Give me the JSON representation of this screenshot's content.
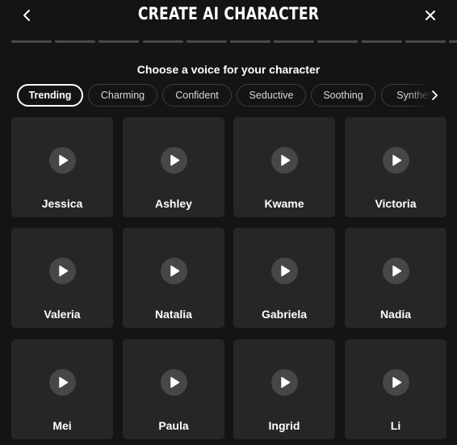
{
  "header": {
    "title": "CREATE AI CHARACTER",
    "back_icon": "chevron-left-icon",
    "close_icon": "close-icon"
  },
  "progress": {
    "steps_total": 11,
    "steps_completed": 0
  },
  "prompt": "Choose a voice for your character",
  "tabs": [
    {
      "label": "Trending",
      "selected": true
    },
    {
      "label": "Charming",
      "selected": false
    },
    {
      "label": "Confident",
      "selected": false
    },
    {
      "label": "Seductive",
      "selected": false
    },
    {
      "label": "Soothing",
      "selected": false
    },
    {
      "label": "Synthetic",
      "selected": false
    }
  ],
  "voices": [
    {
      "name": "Jessica"
    },
    {
      "name": "Ashley"
    },
    {
      "name": "Kwame"
    },
    {
      "name": "Victoria"
    },
    {
      "name": "Valeria"
    },
    {
      "name": "Natalia"
    },
    {
      "name": "Gabriela"
    },
    {
      "name": "Nadia"
    },
    {
      "name": "Mei"
    },
    {
      "name": "Paula"
    },
    {
      "name": "Ingrid"
    },
    {
      "name": "Li"
    }
  ],
  "colors": {
    "background": "#141414",
    "card": "#262626",
    "play_button": "#474747",
    "progress_inactive": "#4a4a4a"
  }
}
